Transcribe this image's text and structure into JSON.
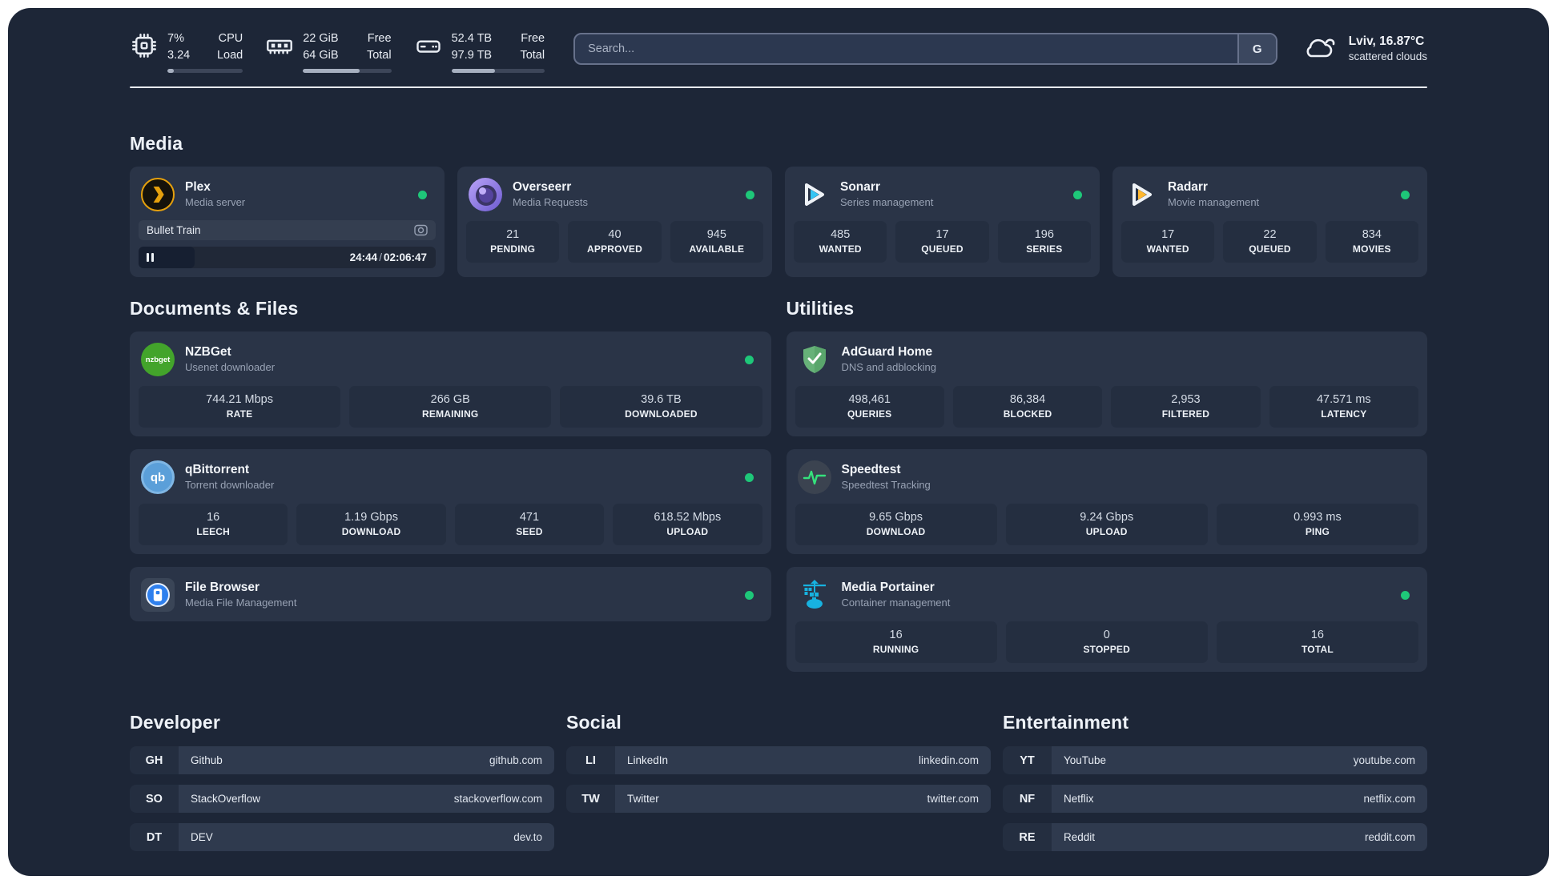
{
  "theme": {
    "panel_bg": "#1d2637",
    "card_bg": "#2a3447",
    "tile_bg": "#242e40",
    "online_green": "#1ec779"
  },
  "header": {
    "metrics": [
      {
        "id": "cpu",
        "icon": "cpu-chip",
        "col1": [
          "7%",
          "3.24"
        ],
        "col2": [
          "CPU",
          "Load"
        ],
        "progress_pct": 8
      },
      {
        "id": "ram",
        "icon": "ram",
        "col1": [
          "22 GiB",
          "64 GiB"
        ],
        "col2": [
          "Free",
          "Total"
        ],
        "progress_pct": 64
      },
      {
        "id": "disk",
        "icon": "disk",
        "col1": [
          "52.4 TB",
          "97.9 TB"
        ],
        "col2": [
          "Free",
          "Total"
        ],
        "progress_pct": 47
      }
    ],
    "search": {
      "placeholder": "Search...",
      "engine_button": "G"
    },
    "weather": {
      "location_temp": "Lviv, 16.87°C",
      "condition": "scattered clouds"
    }
  },
  "sections": {
    "media": {
      "title": "Media",
      "cards": [
        {
          "name": "Plex",
          "subtitle": "Media server",
          "icon": "plex",
          "online": true,
          "player": {
            "track": "Bullet Train",
            "elapsed": "24:44",
            "duration": "02:06:47",
            "progress_pct": 19
          }
        },
        {
          "name": "Overseerr",
          "subtitle": "Media Requests",
          "icon": "overseerr",
          "online": true,
          "stats": [
            {
              "value": "21",
              "label": "PENDING"
            },
            {
              "value": "40",
              "label": "APPROVED"
            },
            {
              "value": "945",
              "label": "AVAILABLE"
            }
          ]
        },
        {
          "name": "Sonarr",
          "subtitle": "Series management",
          "icon": "sonarr",
          "online": true,
          "stats": [
            {
              "value": "485",
              "label": "WANTED"
            },
            {
              "value": "17",
              "label": "QUEUED"
            },
            {
              "value": "196",
              "label": "SERIES"
            }
          ]
        },
        {
          "name": "Radarr",
          "subtitle": "Movie management",
          "icon": "radarr",
          "online": true,
          "stats": [
            {
              "value": "17",
              "label": "WANTED"
            },
            {
              "value": "22",
              "label": "QUEUED"
            },
            {
              "value": "834",
              "label": "MOVIES"
            }
          ]
        }
      ]
    },
    "documents": {
      "title": "Documents & Files",
      "cards": [
        {
          "name": "NZBGet",
          "subtitle": "Usenet downloader",
          "icon": "nzbget",
          "online": true,
          "stats": [
            {
              "value": "744.21 Mbps",
              "label": "RATE"
            },
            {
              "value": "266 GB",
              "label": "REMAINING"
            },
            {
              "value": "39.6 TB",
              "label": "DOWNLOADED"
            }
          ]
        },
        {
          "name": "qBittorrent",
          "subtitle": "Torrent downloader",
          "icon": "qbittorrent",
          "online": true,
          "stats": [
            {
              "value": "16",
              "label": "LEECH"
            },
            {
              "value": "1.19 Gbps",
              "label": "DOWNLOAD"
            },
            {
              "value": "471",
              "label": "SEED"
            },
            {
              "value": "618.52 Mbps",
              "label": "UPLOAD"
            }
          ]
        },
        {
          "name": "File Browser",
          "subtitle": "Media File Management",
          "icon": "filebrowser",
          "online": true,
          "stats": []
        }
      ]
    },
    "utilities": {
      "title": "Utilities",
      "cards": [
        {
          "name": "AdGuard Home",
          "subtitle": "DNS and adblocking",
          "icon": "adguard",
          "online": false,
          "stats": [
            {
              "value": "498,461",
              "label": "QUERIES"
            },
            {
              "value": "86,384",
              "label": "BLOCKED"
            },
            {
              "value": "2,953",
              "label": "FILTERED"
            },
            {
              "value": "47.571 ms",
              "label": "LATENCY"
            }
          ]
        },
        {
          "name": "Speedtest",
          "subtitle": "Speedtest Tracking",
          "icon": "speedtest",
          "online": false,
          "stats": [
            {
              "value": "9.65 Gbps",
              "label": "DOWNLOAD"
            },
            {
              "value": "9.24 Gbps",
              "label": "UPLOAD"
            },
            {
              "value": "0.993 ms",
              "label": "PING"
            }
          ]
        },
        {
          "name": "Media Portainer",
          "subtitle": "Container management",
          "icon": "portainer",
          "online": true,
          "stats": [
            {
              "value": "16",
              "label": "RUNNING"
            },
            {
              "value": "0",
              "label": "STOPPED"
            },
            {
              "value": "16",
              "label": "TOTAL"
            }
          ]
        }
      ]
    },
    "links": [
      {
        "title": "Developer",
        "items": [
          {
            "abbr": "GH",
            "name": "Github",
            "url": "github.com"
          },
          {
            "abbr": "SO",
            "name": "StackOverflow",
            "url": "stackoverflow.com"
          },
          {
            "abbr": "DT",
            "name": "DEV",
            "url": "dev.to"
          }
        ]
      },
      {
        "title": "Social",
        "items": [
          {
            "abbr": "LI",
            "name": "LinkedIn",
            "url": "linkedin.com"
          },
          {
            "abbr": "TW",
            "name": "Twitter",
            "url": "twitter.com"
          }
        ]
      },
      {
        "title": "Entertainment",
        "items": [
          {
            "abbr": "YT",
            "name": "YouTube",
            "url": "youtube.com"
          },
          {
            "abbr": "NF",
            "name": "Netflix",
            "url": "netflix.com"
          },
          {
            "abbr": "RE",
            "name": "Reddit",
            "url": "reddit.com"
          }
        ]
      }
    ]
  }
}
